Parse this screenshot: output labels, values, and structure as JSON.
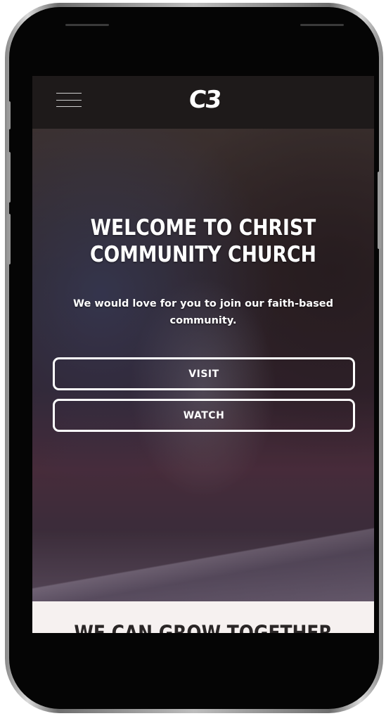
{
  "app": {
    "logo_text": "C3",
    "menu_icon": "hamburger-menu-icon"
  },
  "hero": {
    "title": "WELCOME TO CHRIST COMMUNITY CHURCH",
    "subtitle": "We would love for you to join our faith-based community.",
    "visit_label": "VISIT",
    "watch_label": "WATCH"
  },
  "next_section": {
    "heading": "WE CAN GROW TOGETHER"
  },
  "colors": {
    "topbar": "#1e1a1a",
    "text": "#ffffff",
    "section_bg": "#f6f1f0"
  }
}
